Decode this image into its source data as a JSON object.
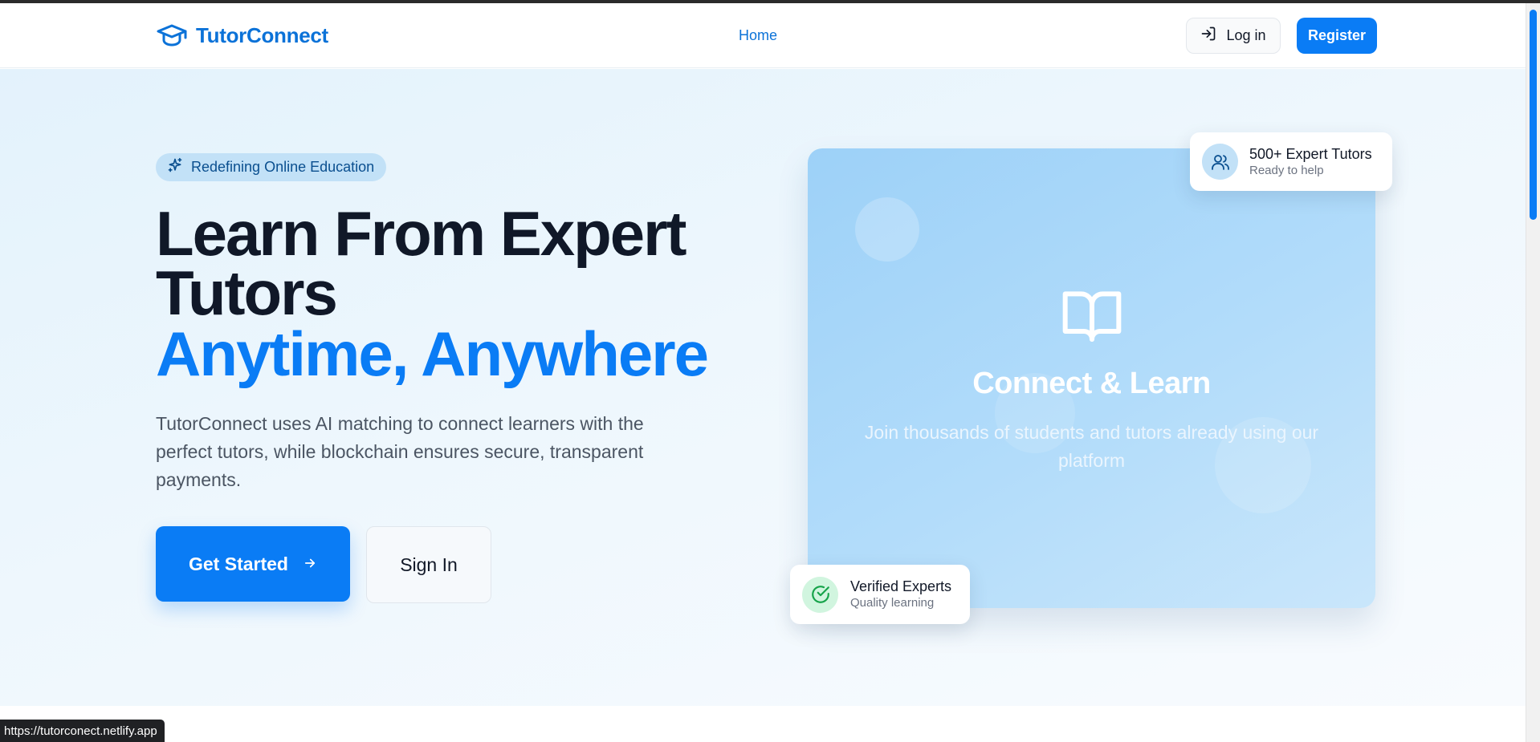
{
  "brand": {
    "name": "TutorConnect",
    "icon": "graduation-cap-icon",
    "color": "#0b72d8"
  },
  "nav": {
    "home_label": "Home",
    "login_label": "Log in",
    "login_icon": "log-in-icon",
    "register_label": "Register"
  },
  "hero": {
    "badge": {
      "icon": "sparkles-icon",
      "label": "Redefining Online Education"
    },
    "headline_line1": "Learn From Expert",
    "headline_line2": "Tutors",
    "headline_accent": "Anytime, Anywhere",
    "description": "TutorConnect uses AI matching to connect learners with the perfect tutors, while blockchain ensures secure, transparent payments.",
    "primary_cta": {
      "label": "Get Started",
      "icon": "arrow-right-icon"
    },
    "secondary_cta": {
      "label": "Sign In"
    }
  },
  "feature_card": {
    "icon": "open-book-icon",
    "title": "Connect & Learn",
    "subtitle": "Join thousands of students and tutors already using our platform"
  },
  "stats": {
    "tutors": {
      "icon": "users-icon",
      "title": "500+ Expert Tutors",
      "subtitle": "Ready to help"
    },
    "verified": {
      "icon": "check-circle-icon",
      "title": "Verified Experts",
      "subtitle": "Quality learning"
    }
  },
  "status_bar": {
    "url": "https://tutorconect.netlify.app"
  },
  "colors": {
    "accent": "#0a7cf5",
    "heading": "#101828",
    "body_text": "#4b5563",
    "badge_bg": "#c2e1f7",
    "card_bg": "#9dd1f8",
    "success": "#16a34a"
  }
}
